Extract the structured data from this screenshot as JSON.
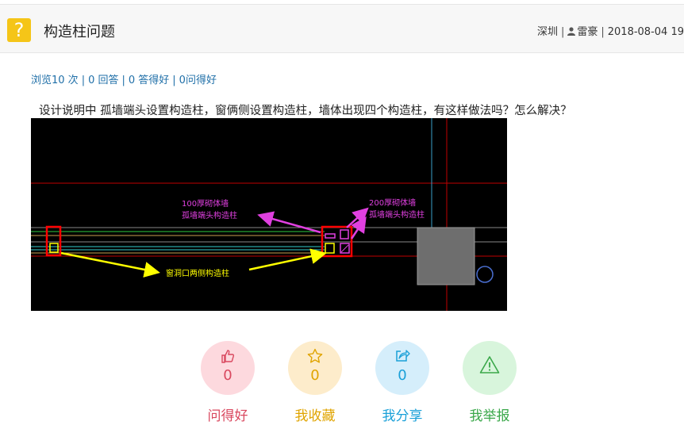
{
  "header": {
    "icon_symbol": "?",
    "title": "构造柱问题",
    "location": "深圳",
    "author": "雷豪",
    "date": "2018-08-04 19"
  },
  "stats": {
    "views": "浏览10 次",
    "answers": "0 回答",
    "answer_good": "0 答得好",
    "question_good": "0问得好"
  },
  "question": {
    "text": "设计说明中 孤墙端头设置构造柱，窗俩侧设置构造柱，墙体出现四个构造柱，有这样做法吗？怎么解决？"
  },
  "figure": {
    "annotations": {
      "wall100_line1": "100厚砌体墙",
      "wall100_line2": "孤墙端头构造柱",
      "wall200_line1": "200厚砌体墙",
      "wall200_line2": "孤墙端头构造柱",
      "window": "窗洞口两侧构造柱"
    },
    "colors": {
      "background": "#000000",
      "magenta": "#e040e0",
      "yellow": "#ffff00",
      "red": "#ff0000"
    }
  },
  "actions": [
    {
      "label": "问得好",
      "count": "0",
      "icon": "thumbs-up-icon",
      "color": "#d9485f",
      "bg": "#fdd9de"
    },
    {
      "label": "我收藏",
      "count": "0",
      "icon": "star-icon",
      "color": "#e0a400",
      "bg": "#fdeccb"
    },
    {
      "label": "我分享",
      "count": "0",
      "icon": "share-icon",
      "color": "#1aa0d8",
      "bg": "#d5eefb"
    },
    {
      "label": "我举报",
      "count": "0",
      "icon": "warning-icon",
      "color": "#3aa84a",
      "bg": "#d8f5dc"
    }
  ]
}
